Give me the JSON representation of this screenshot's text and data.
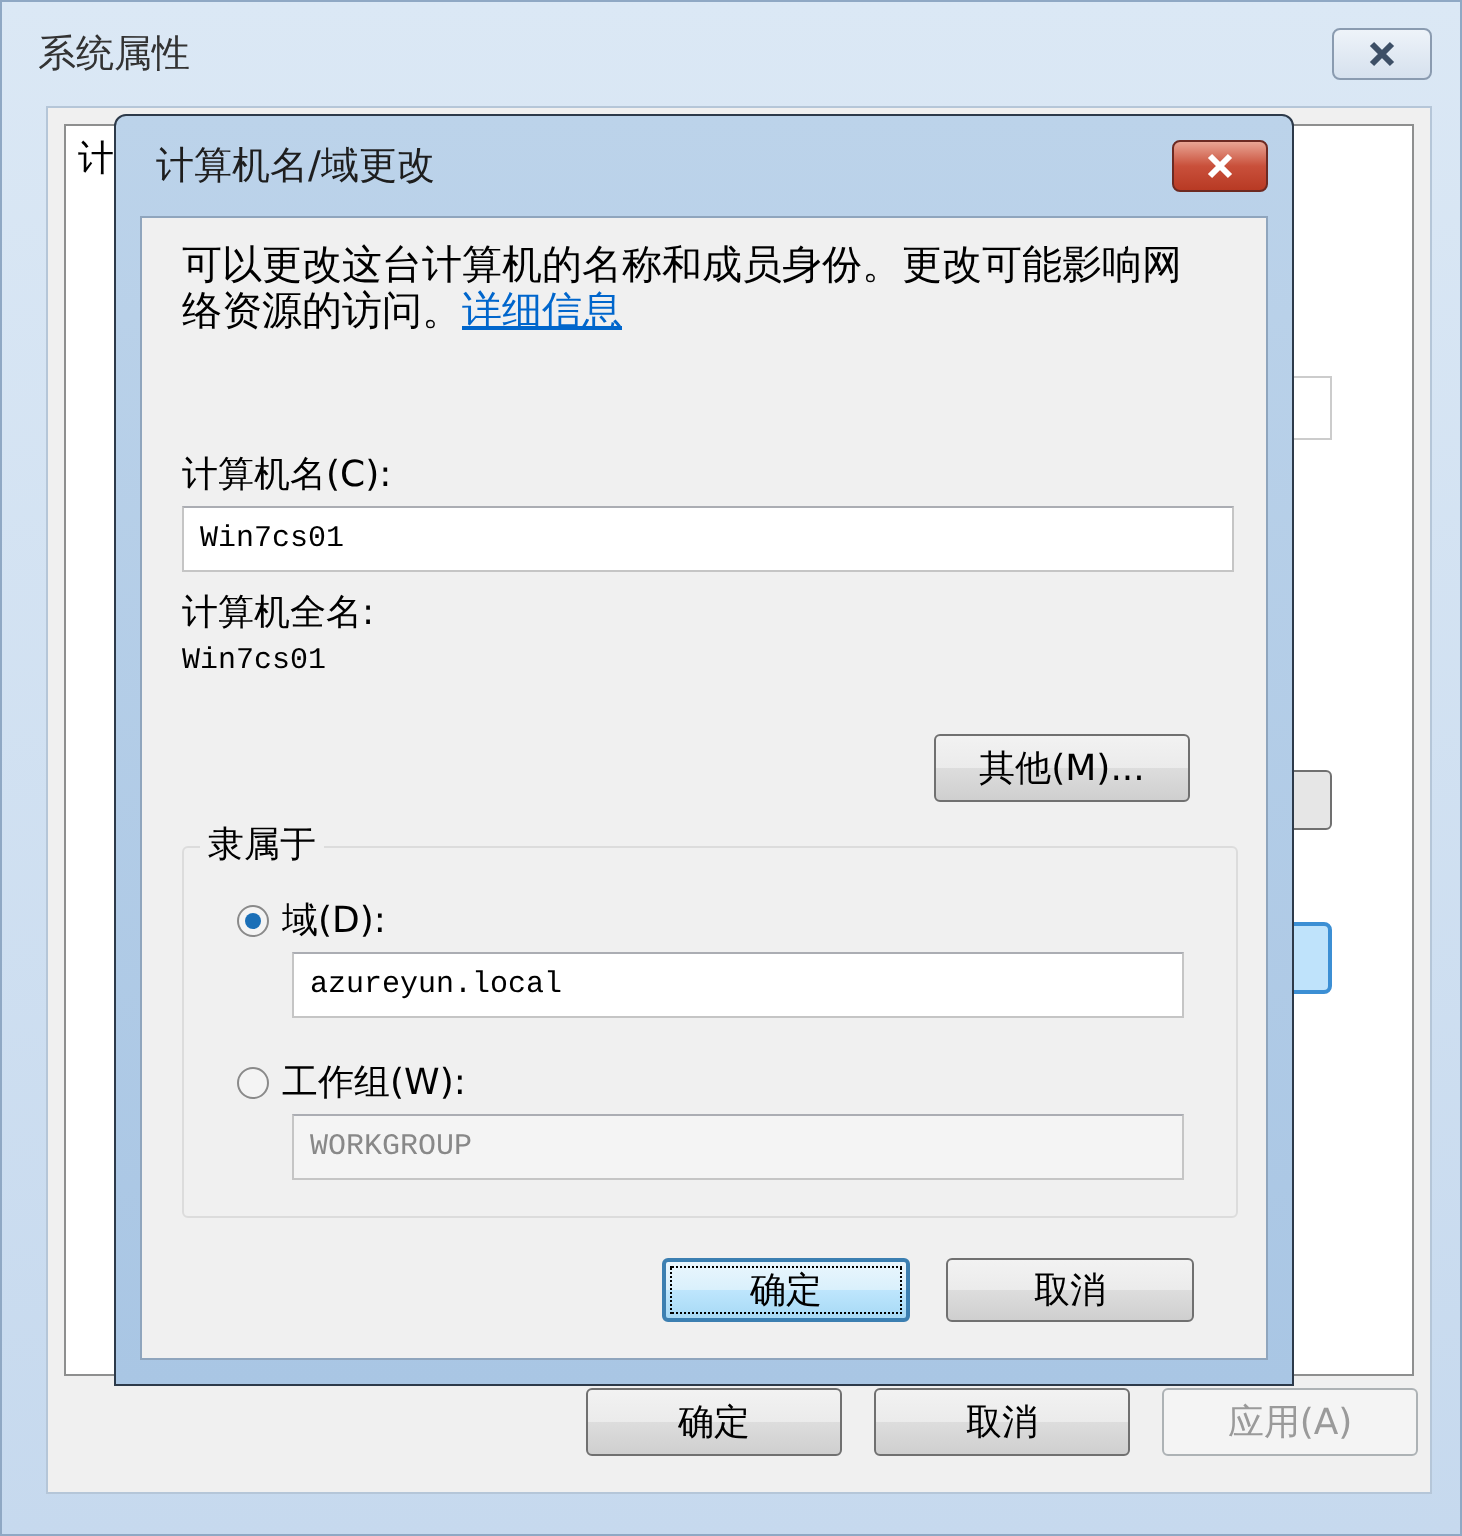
{
  "background_window": {
    "title": "系统属性",
    "tab_fragment": "计",
    "buttons": [
      {
        "label": "确定",
        "disabled": false
      },
      {
        "label": "取消",
        "disabled": false
      },
      {
        "label": "应用(A)",
        "disabled": true
      }
    ]
  },
  "dialog": {
    "title": "计算机名/域更改",
    "description": "可以更改这台计算机的名称和成员身份。更改可能影响网络资源的访问。",
    "link": "详细信息",
    "computer_name_label": "计算机名(C):",
    "computer_name_value": "Win7cs01",
    "full_name_label": "计算机全名:",
    "full_name": "Win7cs01",
    "more_button": "其他(M)...",
    "member_of": {
      "title": "隶属于",
      "options": [
        {
          "label": "域(D):",
          "selected": true,
          "value": "azureyun.local",
          "disabled": false
        },
        {
          "label": "工作组(W):",
          "selected": false,
          "value": "WORKGROUP",
          "disabled": true
        }
      ]
    },
    "buttons": [
      {
        "label": "确定",
        "default": true
      },
      {
        "label": "取消",
        "default": false
      }
    ]
  }
}
